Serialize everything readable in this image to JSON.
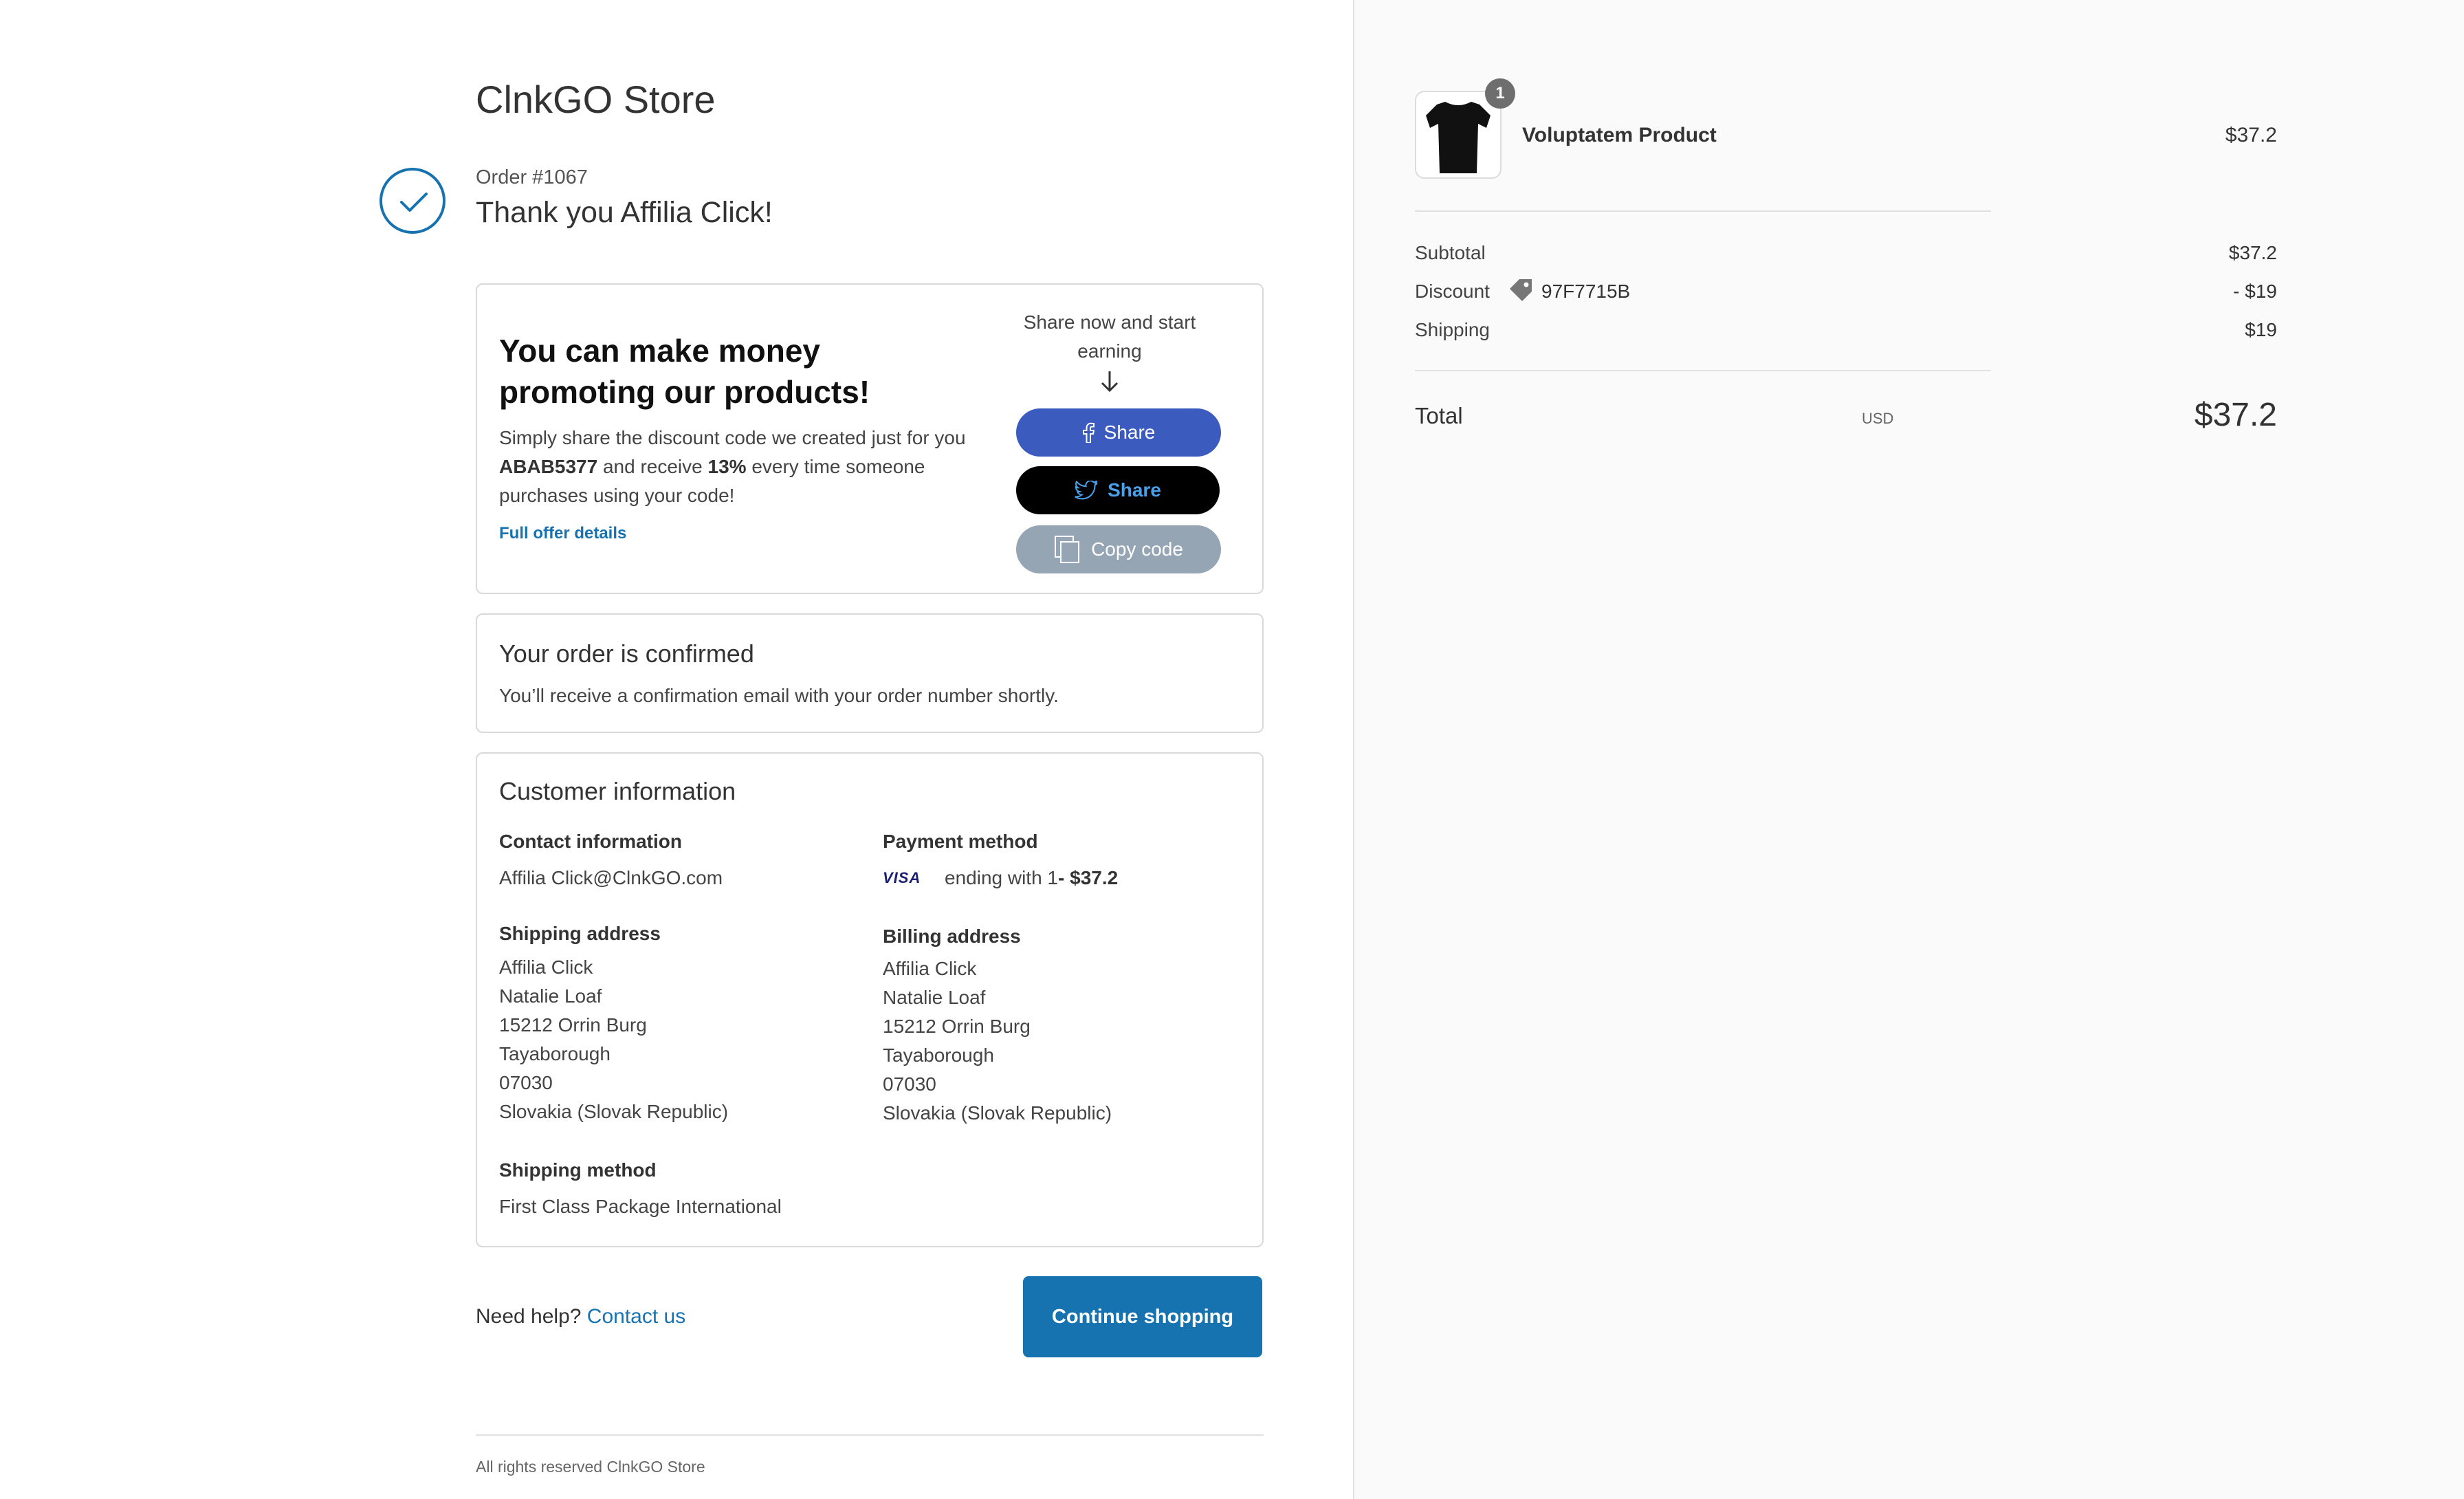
{
  "store": {
    "title": "ClnkGO Store"
  },
  "order": {
    "number": "Order #1067",
    "thanks": "Thank you Affilia Click!"
  },
  "promo": {
    "heading": "You can make money promoting our products!",
    "text_before": "Simply share the discount code we created just for you ",
    "code": "ABAB5377",
    "text_mid": " and receive ",
    "percent": "13%",
    "text_after": " every time someone purchases using your code!",
    "link": "Full offer details",
    "share_now": "Share now and start earning",
    "facebook_label": "Share",
    "twitter_label": "Share",
    "copy_label": "Copy code"
  },
  "confirmed": {
    "heading": "Your order is confirmed",
    "text": "You’ll receive a confirmation email with your order number shortly."
  },
  "customer": {
    "heading": "Customer information",
    "contact_label": "Contact information",
    "contact_value": "Affilia Click@ClnkGO.com",
    "payment_label": "Payment method",
    "card_brand": "VISA",
    "payment_ending": "ending with 1",
    "payment_amount": " - $37.2",
    "shipping_label": "Shipping address",
    "shipping_lines": [
      "Affilia Click",
      "Natalie Loaf",
      "15212 Orrin Burg",
      "Tayaborough",
      "07030",
      "Slovakia (Slovak Republic)"
    ],
    "billing_label": "Billing address",
    "billing_lines": [
      "Affilia Click",
      "Natalie Loaf",
      "15212 Orrin Burg",
      "Tayaborough",
      "07030",
      "Slovakia (Slovak Republic)"
    ],
    "method_label": "Shipping method",
    "method_value": "First Class Package International"
  },
  "help": {
    "text": "Need help? ",
    "link": "Contact us"
  },
  "continue_label": "Continue shopping",
  "footer": "All rights reserved ClnkGO Store",
  "summary": {
    "product_name": "Voluptatem Product",
    "product_price": "$37.2",
    "quantity": "1",
    "subtotal_label": "Subtotal",
    "subtotal_value": "$37.2",
    "discount_label": "Discount",
    "discount_code": "97F7715B",
    "discount_value": "- $19",
    "shipping_label": "Shipping",
    "shipping_value": "$19",
    "total_label": "Total",
    "currency": "USD",
    "total_value": "$37.2"
  },
  "colors": {
    "accent": "#1773b0",
    "facebook": "#3b5bbf",
    "twitter_text": "#4aa1eb",
    "copy": "#96a5b4"
  }
}
